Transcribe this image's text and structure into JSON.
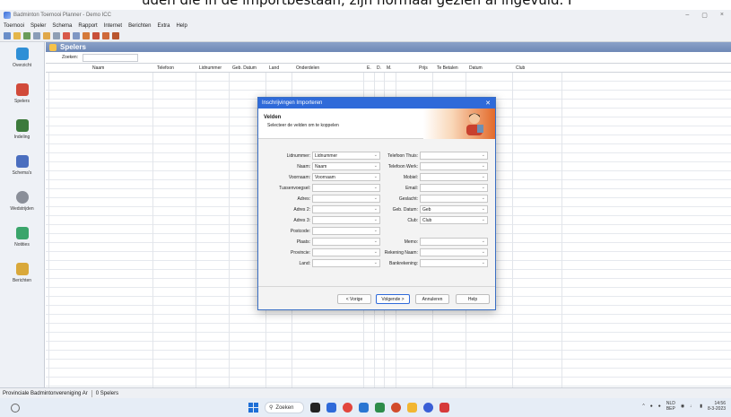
{
  "caption": "uden die in de importbestaan, zijn normaal gezien al ingevuld. I",
  "window": {
    "title": "Badminton Toernooi Planner - Demo ICC",
    "controls": [
      "–",
      "▢",
      "×"
    ]
  },
  "menu": [
    "Toernooi",
    "Speler",
    "Schema",
    "Rapport",
    "Internet",
    "Berichten",
    "Extra",
    "Help"
  ],
  "nav": [
    {
      "label": "Overzicht",
      "icon": "overview-icon",
      "color": "#2f8fd6"
    },
    {
      "label": "Spelers",
      "icon": "players-icon",
      "color": "#d14a3a"
    },
    {
      "label": "Indeling",
      "icon": "layout-icon",
      "color": "#3c7a3c"
    },
    {
      "label": "Schema's",
      "icon": "schedule-icon",
      "color": "#4a6ebf"
    },
    {
      "label": "Wedstrijden",
      "icon": "shuttlecock-icon",
      "color": "#8a8f99"
    },
    {
      "label": "Notities",
      "icon": "notes-icon",
      "color": "#3aa56b"
    },
    {
      "label": "Berichten",
      "icon": "messages-icon",
      "color": "#d9a83a"
    }
  ],
  "panel": {
    "title": "Spelers",
    "search_label": "Zoeken:",
    "search_value": ""
  },
  "columns": [
    "Naam",
    "Telefoon",
    "Lidnummer",
    "Geb. Datum",
    "Land",
    "Onderdelen",
    "E.",
    "D.",
    "M.",
    "Prijs",
    "Te Betalen",
    "Datum",
    "Club"
  ],
  "dialog": {
    "title": "Inschrijvingen Importeren",
    "heading": "Velden",
    "subheading": "Selecteer de velden om te koppelen",
    "left_fields": [
      {
        "label": "Lidnummer:",
        "value": "Lidnummer"
      },
      {
        "label": "Naam:",
        "value": "Naam"
      },
      {
        "label": "Voornaam:",
        "value": "Voornaam"
      },
      {
        "label": "Tussenvoegsel:",
        "value": ""
      },
      {
        "label": "Adres:",
        "value": ""
      },
      {
        "label": "Adres 2:",
        "value": ""
      },
      {
        "label": "Adres 3:",
        "value": ""
      },
      {
        "label": "Postcode:",
        "value": ""
      },
      {
        "label": "Plaats:",
        "value": ""
      },
      {
        "label": "Provincie:",
        "value": ""
      },
      {
        "label": "Land:",
        "value": ""
      }
    ],
    "right_fields": [
      {
        "label": "Telefoon Thuis:",
        "value": ""
      },
      {
        "label": "Telefoon Werk:",
        "value": ""
      },
      {
        "label": "Mobiel:",
        "value": ""
      },
      {
        "label": "Email:",
        "value": ""
      },
      {
        "label": "Geslacht:",
        "value": ""
      },
      {
        "label": "Geb. Datum:",
        "value": "Geb"
      },
      {
        "label": "Club:",
        "value": "Club"
      },
      {
        "label": "",
        "value": ""
      },
      {
        "label": "Memo:",
        "value": ""
      },
      {
        "label": "Rekening Naam:",
        "value": ""
      },
      {
        "label": "Bankrekening:",
        "value": ""
      }
    ],
    "buttons": {
      "prev": "< Vorige",
      "next": "Volgende >",
      "cancel": "Annuleren",
      "help": "Help"
    }
  },
  "status": {
    "org": "Provinciale Badmintonvereniging Ar",
    "count": "0 Spelers"
  },
  "taskbar": {
    "search_label": "Zoeken",
    "lang": "NLD",
    "region": "BEP",
    "time": "14:56",
    "date": "8-3-2023"
  }
}
